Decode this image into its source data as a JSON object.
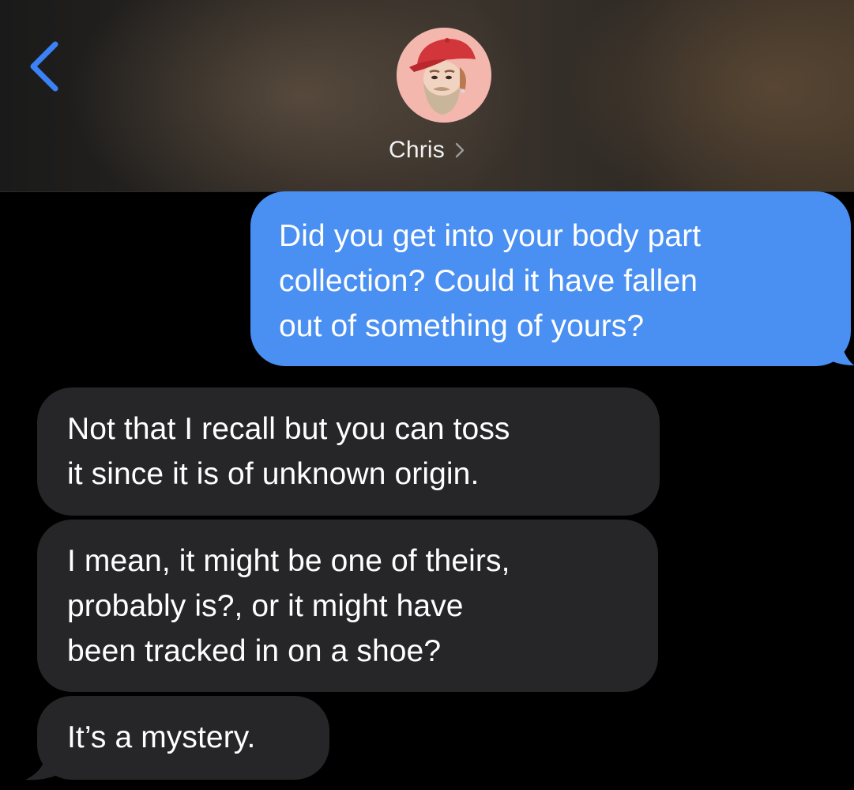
{
  "header": {
    "contact_name": "Chris",
    "back_icon": "chevron-left-icon",
    "name_icon": "chevron-right-icon",
    "avatar": "memoji-avatar",
    "accent_color": "#3b82f6"
  },
  "messages": [
    {
      "direction": "sent",
      "lines": [
        "Did you get into your body part",
        "collection? Could it have fallen",
        "out of something of yours?"
      ]
    },
    {
      "direction": "received",
      "lines": [
        "Not that I recall but you can toss",
        "it since it is of unknown origin."
      ]
    },
    {
      "direction": "received",
      "lines": [
        "I mean, it might be one of theirs,",
        "probably is?, or it might have",
        "been tracked in on a shoe?"
      ]
    },
    {
      "direction": "received",
      "lines": [
        "It’s a mystery."
      ]
    }
  ],
  "colors": {
    "sent_bubble": "#4a8ff2",
    "received_bubble": "#262628",
    "background": "#000000"
  }
}
